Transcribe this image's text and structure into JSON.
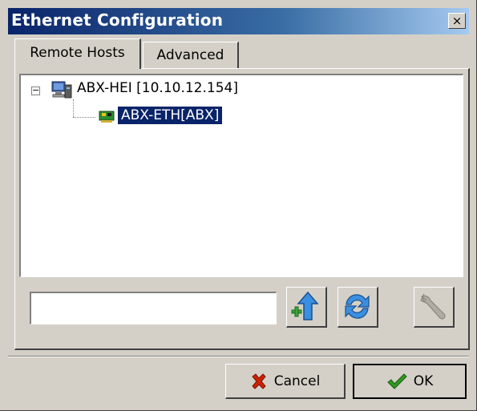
{
  "window": {
    "title": "Ethernet Configuration",
    "close_glyph": "×"
  },
  "tabs": [
    {
      "label": "Remote Hosts",
      "active": true
    },
    {
      "label": "Advanced",
      "active": false
    }
  ],
  "tree": {
    "root": {
      "expander": "−",
      "icon": "computer-icon",
      "label": "ABX-HEI [10.10.12.154]",
      "children": [
        {
          "icon": "network-card-icon",
          "label": "ABX-ETH[ABX]",
          "selected": true
        }
      ]
    }
  },
  "toolbar": {
    "input_value": "",
    "buttons": [
      {
        "icon": "add-upload-icon",
        "enabled": true
      },
      {
        "icon": "refresh-icon",
        "enabled": true
      },
      {
        "icon": "wrench-icon",
        "enabled": false
      }
    ]
  },
  "footer": {
    "cancel_label": "Cancel",
    "ok_label": "OK"
  },
  "colors": {
    "selection": "#0a246a",
    "face": "#d4d0c8",
    "cancel_x": "#cc2200",
    "ok_check": "#2e9a1e"
  }
}
